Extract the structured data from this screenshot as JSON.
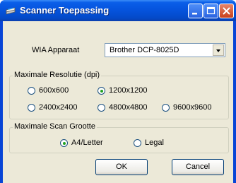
{
  "window": {
    "title": "Scanner Toepassing"
  },
  "device": {
    "label": "WIA Apparaat",
    "selected": "Brother DCP-8025D"
  },
  "resolution": {
    "group_label": "Maximale Resolutie (dpi)",
    "options": [
      {
        "label": "600x600",
        "selected": false
      },
      {
        "label": "1200x1200",
        "selected": true
      },
      {
        "label": "2400x2400",
        "selected": false
      },
      {
        "label": "4800x4800",
        "selected": false
      },
      {
        "label": "9600x9600",
        "selected": false
      }
    ]
  },
  "scan_size": {
    "group_label": "Maximale Scan Grootte",
    "options": [
      {
        "label": "A4/Letter",
        "selected": true
      },
      {
        "label": "Legal",
        "selected": false
      }
    ]
  },
  "buttons": {
    "ok": "OK",
    "cancel": "Cancel"
  }
}
